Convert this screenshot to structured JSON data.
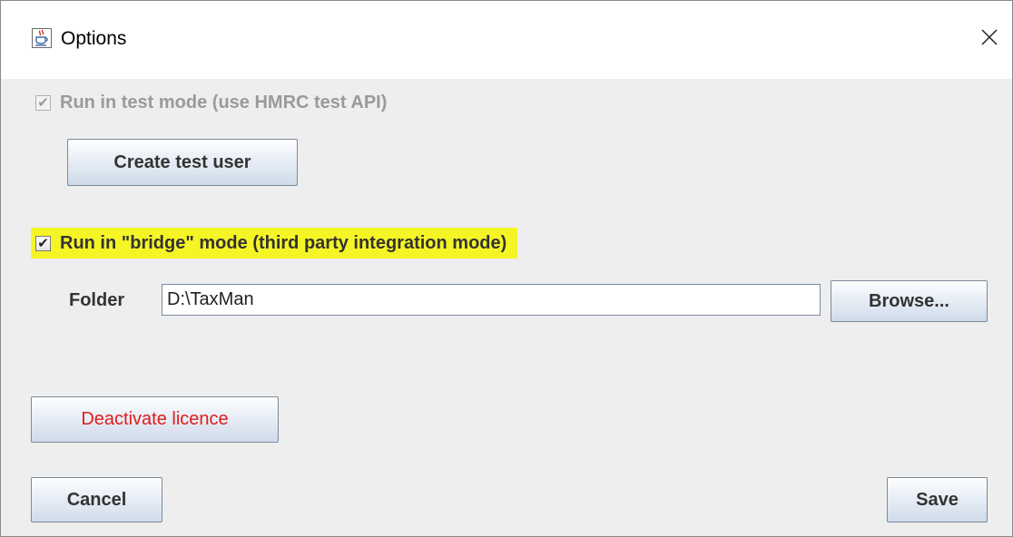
{
  "window": {
    "title": "Options",
    "app_icon": "java-cup-icon",
    "close_icon": "close-icon"
  },
  "test_mode": {
    "label": "Run in test mode (use HMRC test API)",
    "checked": true,
    "enabled": false
  },
  "create_test_user": {
    "label": "Create test user"
  },
  "bridge_mode": {
    "label": "Run in \"bridge\" mode (third party integration mode)",
    "checked": true,
    "enabled": true
  },
  "folder": {
    "label": "Folder",
    "value": "D:\\TaxMan",
    "browse_label": "Browse..."
  },
  "deactivate": {
    "label": "Deactivate licence"
  },
  "footer": {
    "cancel_label": "Cancel",
    "save_label": "Save"
  },
  "colors": {
    "highlight": "#f5f526",
    "danger_text": "#e01b1b",
    "dialog_bg": "#eeeeee"
  }
}
